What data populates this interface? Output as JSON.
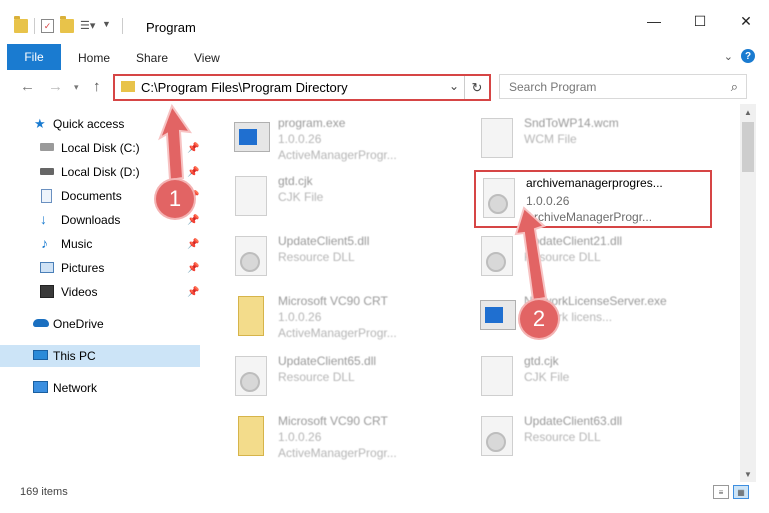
{
  "window": {
    "title": "Program"
  },
  "ribbon": {
    "tabs": [
      "File",
      "Home",
      "Share",
      "View"
    ]
  },
  "address": {
    "path": "C:\\Program Files\\Program Directory"
  },
  "search": {
    "placeholder": "Search Program"
  },
  "sidebar": {
    "items": [
      {
        "label": "Quick access",
        "icon": "star-icon",
        "pinned": false
      },
      {
        "label": "Local Disk (C:)",
        "icon": "drive-icon",
        "pinned": true
      },
      {
        "label": "Local Disk (D:)",
        "icon": "drive-icon",
        "pinned": true
      },
      {
        "label": "Documents",
        "icon": "documents-icon",
        "pinned": true
      },
      {
        "label": "Downloads",
        "icon": "download-icon",
        "pinned": true
      },
      {
        "label": "Music",
        "icon": "music-icon",
        "pinned": true
      },
      {
        "label": "Pictures",
        "icon": "pictures-icon",
        "pinned": true
      },
      {
        "label": "Videos",
        "icon": "videos-icon",
        "pinned": true
      },
      {
        "label": "OneDrive",
        "icon": "cloud-icon",
        "pinned": false
      },
      {
        "label": "This PC",
        "icon": "computer-icon",
        "pinned": false,
        "selected": true
      },
      {
        "label": "Network",
        "icon": "network-icon",
        "pinned": false
      }
    ]
  },
  "files": [
    {
      "name": "program.exe",
      "l1": "1.0.0.26",
      "l2": "ActiveManagerProgr...",
      "kind": "exe-setup"
    },
    {
      "name": "SndToWP14.wcm",
      "l1": "WCM File",
      "l2": "",
      "kind": "doc"
    },
    {
      "name": "gtd.cjk",
      "l1": "CJK File",
      "l2": "",
      "kind": "doc"
    },
    {
      "name": "archivemanagerprogres...",
      "l1": "1.0.0.26",
      "l2": "ArchiveManagerProgr...",
      "kind": "dll",
      "highlighted": true
    },
    {
      "name": "UpdateClient5.dll",
      "l1": "Resource DLL",
      "l2": "",
      "kind": "dll"
    },
    {
      "name": "UpdateClient21.dll",
      "l1": "Resource DLL",
      "l2": "",
      "kind": "dll"
    },
    {
      "name": "Microsoft VC90 CRT",
      "l1": "1.0.0.26",
      "l2": "ActiveManagerProgr...",
      "kind": "zip"
    },
    {
      "name": "NetworkLicenseServer.exe",
      "l1": "Network licens...",
      "l2": "",
      "kind": "exe"
    },
    {
      "name": "UpdateClient65.dll",
      "l1": "Resource DLL",
      "l2": "",
      "kind": "dll"
    },
    {
      "name": "gtd.cjk",
      "l1": "CJK File",
      "l2": "",
      "kind": "doc"
    },
    {
      "name": "Microsoft VC90 CRT",
      "l1": "1.0.0.26",
      "l2": "ActiveManagerProgr...",
      "kind": "zip"
    },
    {
      "name": "UpdateClient63.dll",
      "l1": "Resource DLL",
      "l2": "",
      "kind": "dll"
    }
  ],
  "status": {
    "count": "169 items"
  },
  "annotations": [
    {
      "number": "1"
    },
    {
      "number": "2"
    }
  ],
  "colors": {
    "accent": "#1a7bd0",
    "highlight": "#d64545",
    "badge": "#e26464"
  }
}
